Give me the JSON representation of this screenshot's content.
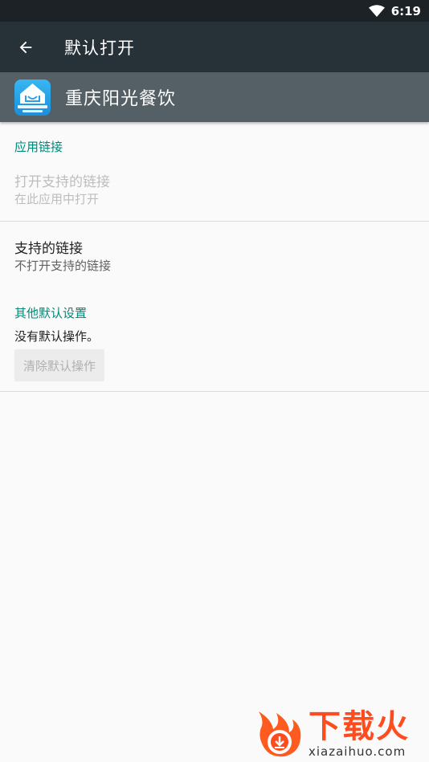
{
  "status_bar": {
    "time": "6:19"
  },
  "toolbar": {
    "title": "默认打开"
  },
  "app": {
    "name": "重庆阳光餐饮"
  },
  "app_links": {
    "section_title": "应用链接",
    "open_supported": {
      "title": "打开支持的链接",
      "subtitle": "在此应用中打开"
    },
    "supported_links": {
      "title": "支持的链接",
      "subtitle": "不打开支持的链接"
    }
  },
  "other_defaults": {
    "section_title": "其他默认设置",
    "description": "没有默认操作。",
    "clear_button_label": "清除默认操作"
  },
  "watermark": {
    "title": "下载火",
    "url": "xiazaihuo.com"
  },
  "colors": {
    "toolbar": "#263238",
    "app_header": "#546065",
    "accent": "#00897b",
    "watermark": "#ff4c1f"
  }
}
